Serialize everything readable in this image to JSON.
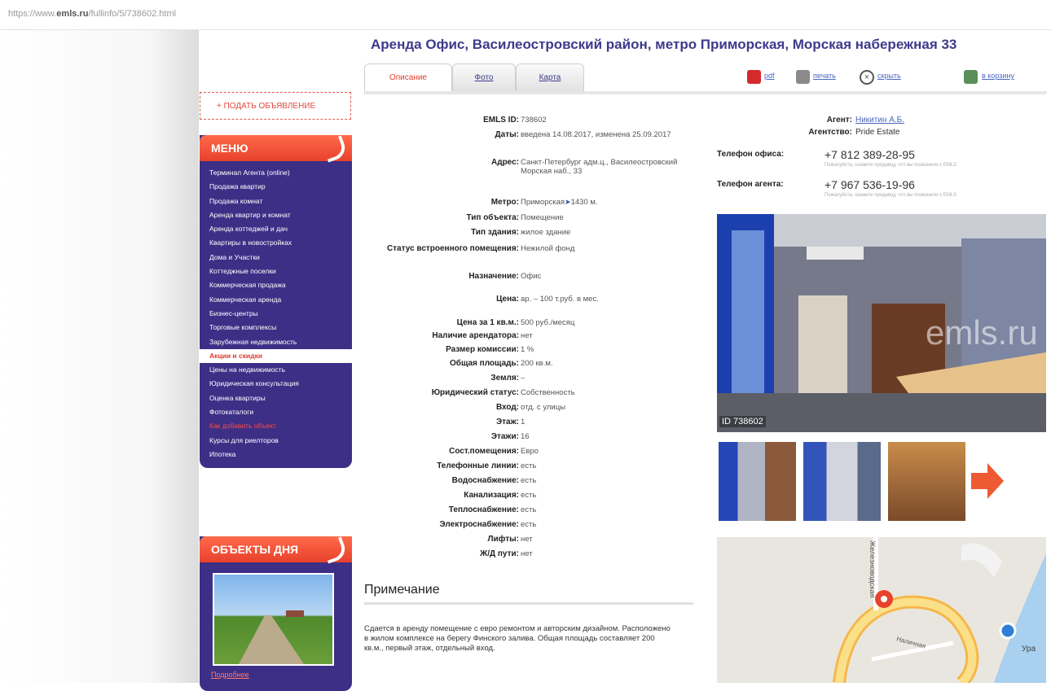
{
  "browser": {
    "url_prefix": "https://www.",
    "url_domain": "emls.ru",
    "url_path": "/fullinfo/5/738602.html"
  },
  "page": {
    "title": "Аренда Офис, Василеостровский район, метро Приморская, Морская набережная 33"
  },
  "sidebar": {
    "submit_ad": "+ ПОДАТЬ ОБЪЯВЛЕНИЕ",
    "menu_title": "МЕНЮ",
    "menu_items": [
      {
        "label": "Терминал Агента (online)"
      },
      {
        "label": "Продажа квартир"
      },
      {
        "label": "Продажа комнат"
      },
      {
        "label": "Аренда квартир и комнат"
      },
      {
        "label": "Аренда коттеджей и дач"
      },
      {
        "label": "Квартиры в новостройках"
      },
      {
        "label": "Дома и Участки"
      },
      {
        "label": "Коттеджные поселки"
      },
      {
        "label": "Коммерческая продажа"
      },
      {
        "label": "Коммерческая аренда"
      },
      {
        "label": "Бизнес-центры"
      },
      {
        "label": "Торговые комплексы"
      },
      {
        "label": "Зарубежная недвижимость"
      },
      {
        "label": "Акции и скидки",
        "state": "active"
      },
      {
        "label": "Цены на недвижимость"
      },
      {
        "label": "Юридическая консультация"
      },
      {
        "label": "Оценка квартиры"
      },
      {
        "label": "Фотокаталоги"
      },
      {
        "label": "Как добавить объект",
        "state": "highlight"
      },
      {
        "label": "Курсы для риелторов"
      },
      {
        "label": "Ипотека"
      }
    ],
    "objects_title": "ОБЪЕКТЫ ДНЯ",
    "objects_link": "Подробнее"
  },
  "tabs": [
    {
      "label": "Описание",
      "active": true
    },
    {
      "label": "Фото",
      "active": false
    },
    {
      "label": "Карта",
      "active": false
    }
  ],
  "toolbar": {
    "pdf": "pdf",
    "print": "печать",
    "hide": "скрыть",
    "cart": "в корзину"
  },
  "properties": [
    {
      "label": "EMLS ID:",
      "value": "738602"
    },
    {
      "label": "Даты:",
      "value": "введена 14.08.2017, изменена 25.09.2017"
    },
    {
      "label": "Адрес:",
      "value": "Санкт-Петербург адм.ц., Василеостровский Морская наб., 33"
    },
    {
      "label": "Метро:",
      "value": "Приморская",
      "extra": "1430 м."
    },
    {
      "label": "Тип объекта:",
      "value": "Помещение"
    },
    {
      "label": "Тип здания:",
      "value": "жилое здание"
    },
    {
      "label": "Статус встроенного помещения:",
      "value": "Нежилой фонд"
    },
    {
      "label": "Назначение:",
      "value": "Офис"
    },
    {
      "label": "Цена:",
      "value": "ар. – 100 т.руб. в мес."
    },
    {
      "label": "Цена за 1 кв.м.:",
      "value": "500 руб./месяц"
    },
    {
      "label": "Наличие арендатора:",
      "value": "нет"
    },
    {
      "label": "Размер комиссии:",
      "value": "1 %"
    },
    {
      "label": "Общая площадь:",
      "value": "200 кв.м."
    },
    {
      "label": "Земля:",
      "value": "–"
    },
    {
      "label": "Юридический статус:",
      "value": "Собственность"
    },
    {
      "label": "Вход:",
      "value": "отд. с улицы"
    },
    {
      "label": "Этаж:",
      "value": "1"
    },
    {
      "label": "Этажи:",
      "value": "16"
    },
    {
      "label": "Сост.помещения:",
      "value": "Евро"
    },
    {
      "label": "Телефонные линии:",
      "value": "есть"
    },
    {
      "label": "Водоснабжение:",
      "value": "есть"
    },
    {
      "label": "Канализация:",
      "value": "есть"
    },
    {
      "label": "Теплоснабжение:",
      "value": "есть"
    },
    {
      "label": "Электроснабжение:",
      "value": "есть"
    },
    {
      "label": "Лифты:",
      "value": "нет"
    },
    {
      "label": "Ж/Д пути:",
      "value": "нет"
    }
  ],
  "note": {
    "title": "Примечание",
    "text": "Сдается в аренду помещение с евро ремонтом и авторским дизайном. Расположено в жилом комплексе на берегу Финского залива. Общая площадь составляет 200 кв.м., первый этаж, отдельный вход."
  },
  "agent": {
    "agent_label": "Агент:",
    "agent_name": "Никитин А.Б.",
    "agency_label": "Агентство:",
    "agency_name": "Pride Estate",
    "office_phone_label": "Телефон офиса:",
    "office_phone": "+7 812 389-28-95",
    "agent_phone_label": "Телефон агента:",
    "agent_phone": "+7 967 536-19-96",
    "phone_note": "Пожалуйста, скажите продавцу, что вы позвонили с EMLS"
  },
  "photo": {
    "watermark": "emls.ru",
    "id_label": "ID 738602"
  },
  "map": {
    "street_vertical": "Железноводская",
    "street_curve": "Наличная",
    "street_label": "Ура"
  },
  "colors": {
    "brand_purple": "#3d2f86",
    "accent_red": "#e8412c",
    "title_blue": "#3d3a8c",
    "link_blue": "#4a67c0"
  }
}
